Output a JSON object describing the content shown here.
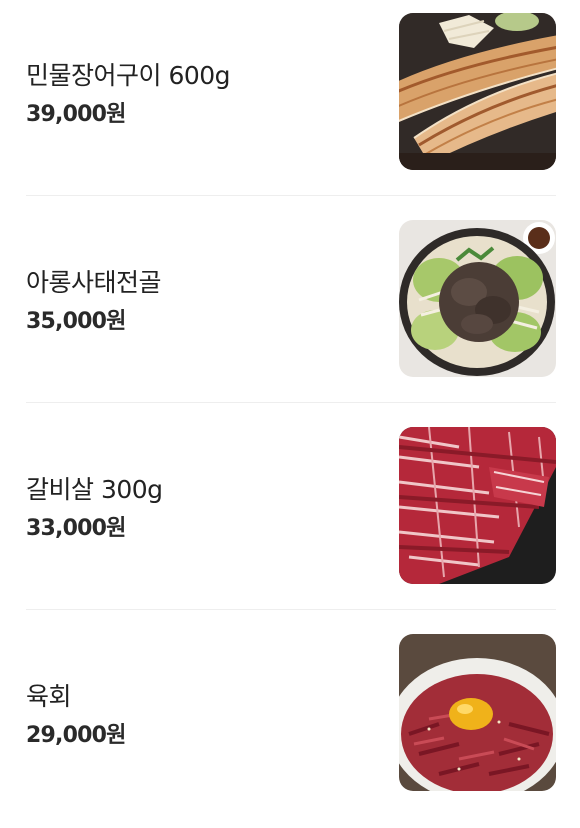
{
  "menu": {
    "items": [
      {
        "name": "민물장어구이 600g",
        "price": "39,000원",
        "image_icon": "grilled-eel-photo"
      },
      {
        "name": "아롱사태전골",
        "price": "35,000원",
        "image_icon": "beef-shank-hotpot-photo"
      },
      {
        "name": "갈비살 300g",
        "price": "33,000원",
        "image_icon": "raw-rib-meat-photo"
      },
      {
        "name": "육회",
        "price": "29,000원",
        "image_icon": "beef-tartare-photo"
      }
    ]
  }
}
